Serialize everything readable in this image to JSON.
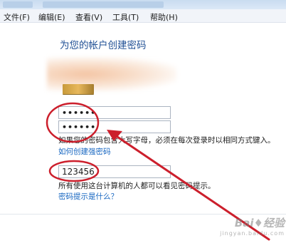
{
  "menu": [
    "文件(F)",
    "编辑(E)",
    "查看(V)",
    "工具(T)",
    "帮助(H)"
  ],
  "form": {
    "heading": "为您的帐户创建密码",
    "new_password_value": "••••••",
    "confirm_password_value": "••••••",
    "caps_warning": "如果您的密码包含大写字母，必须在每次登录时以相同方式键入。",
    "strong_password_link": "如何创建强密码",
    "hint_value": "123456",
    "hint_note": "所有使用这台计算机的人都可以看见密码提示。",
    "hint_link": "密码提示是什么？"
  },
  "annotation": {
    "color": "#cc1f2c"
  },
  "watermark": {
    "logo": "Bai♦经验",
    "url": "jingyan.baidu.com"
  }
}
